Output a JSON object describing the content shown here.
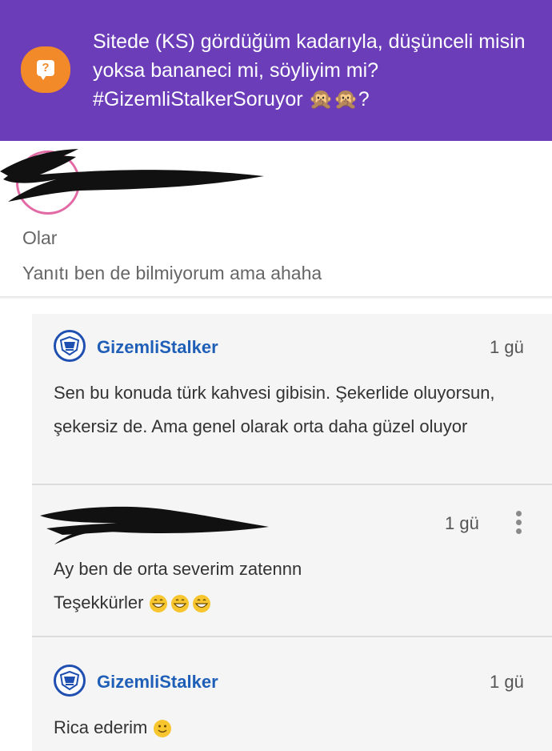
{
  "question": {
    "icon": "question-bubble-icon",
    "text": "Sitede (KS) gördüğüm kadarıyla, düşünceli misin yoksa bananeci mi, söyliyim mi? #GizemliStalkerSoruyor 🙊🙊?"
  },
  "reply": {
    "title": "Olar",
    "text": "Yanıtı ben de bilmiyorum ama ahaha"
  },
  "comments": [
    {
      "author": "GizemliStalker",
      "time": "1 gü",
      "text": "Sen bu konuda türk kahvesi gibisin. Şekerlide oluyorsun, şekersiz de. Ama genel olarak orta daha güzel oluyor"
    },
    {
      "author": "",
      "time": "1 gü",
      "line1": "Ay ben de orta severim zatennn",
      "line2": "Teşekkürler"
    },
    {
      "author": "GizemliStalker",
      "time": "1 gü",
      "text": "Rica ederim"
    }
  ],
  "colors": {
    "header_bg": "#6b3db8",
    "question_icon": "#f28a2a",
    "author": "#1f5fb7",
    "avatar_ring": "#e36aa5"
  }
}
